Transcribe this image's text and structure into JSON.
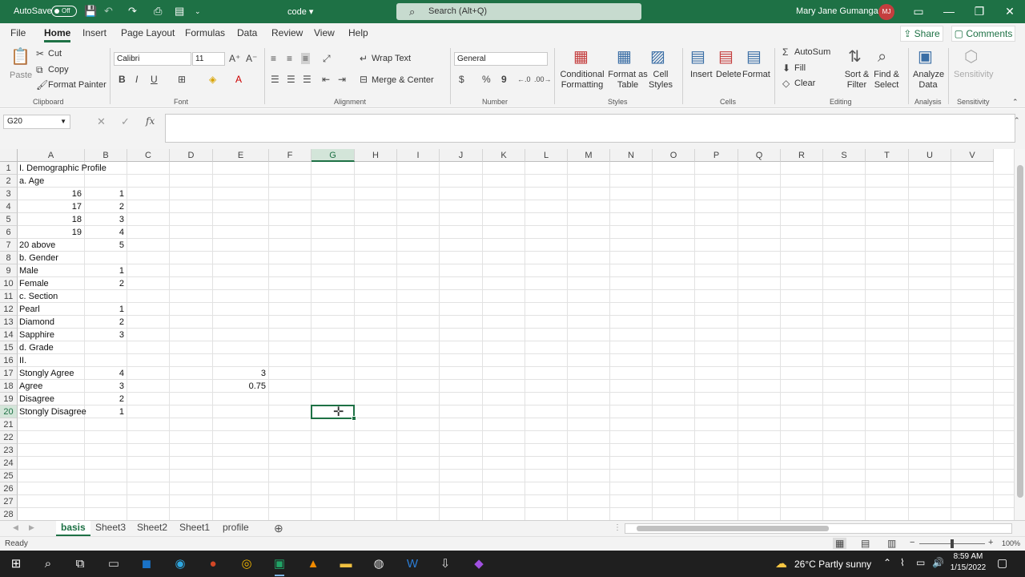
{
  "titlebar": {
    "autosave_label": "AutoSave",
    "autosave_state": "Off",
    "doc_title": "code",
    "doc_title_chevron": "▾",
    "search_placeholder": "Search (Alt+Q)",
    "user_name": "Mary Jane Gumangan",
    "user_initials": "MJ",
    "qat": [
      "save-icon",
      "undo-icon",
      "redo-icon",
      "print-preview-icon",
      "pdf-icon",
      "customize-icon"
    ]
  },
  "menu_tabs": [
    "File",
    "Home",
    "Insert",
    "Page Layout",
    "Formulas",
    "Data",
    "Review",
    "View",
    "Help"
  ],
  "active_tab": "Home",
  "share_label": "Share",
  "comments_label": "Comments",
  "ribbon": {
    "clipboard": {
      "group": "Clipboard",
      "paste": "Paste",
      "cut": "Cut",
      "copy": "Copy",
      "format_painter": "Format Painter"
    },
    "font": {
      "group": "Font",
      "name": "Calibri",
      "size": "11",
      "bold": "B",
      "italic": "I",
      "underline": "U"
    },
    "alignment": {
      "group": "Alignment",
      "wrap_text": "Wrap Text",
      "merge_center": "Merge & Center"
    },
    "number": {
      "group": "Number",
      "format": "General",
      "currency": "$",
      "percent": "%",
      "comma": "9"
    },
    "styles": {
      "group": "Styles",
      "conditional": "Conditional Formatting",
      "format_table": "Format as Table",
      "cell_styles": "Cell Styles"
    },
    "cells": {
      "group": "Cells",
      "insert": "Insert",
      "delete": "Delete",
      "format": "Format"
    },
    "editing": {
      "group": "Editing",
      "autosum": "AutoSum",
      "fill": "Fill",
      "clear": "Clear",
      "sort_filter": "Sort & Filter",
      "find_select": "Find & Select"
    },
    "analysis": {
      "group": "Analysis",
      "analyze": "Analyze Data"
    },
    "sensitivity": {
      "group": "Sensitivity",
      "label": "Sensitivity"
    }
  },
  "name_box": "G20",
  "formula_value": "",
  "columns": [
    "A",
    "B",
    "C",
    "D",
    "E",
    "F",
    "G",
    "H",
    "I",
    "J",
    "K",
    "L",
    "M",
    "N",
    "O",
    "P",
    "Q",
    "R",
    "S",
    "T",
    "U",
    "V"
  ],
  "selected_column": "G",
  "selected_row": 20,
  "rows": [
    1,
    2,
    3,
    4,
    5,
    6,
    7,
    8,
    9,
    10,
    11,
    12,
    13,
    14,
    15,
    16,
    17,
    18,
    19,
    20,
    21,
    22,
    23,
    24,
    25,
    26,
    27,
    28
  ],
  "cells": [
    {
      "row": 1,
      "col": "A",
      "value": "I. Demographic Profile",
      "align": "left"
    },
    {
      "row": 2,
      "col": "A",
      "value": "a. Age",
      "align": "left"
    },
    {
      "row": 3,
      "col": "A",
      "value": "16",
      "align": "right"
    },
    {
      "row": 3,
      "col": "B",
      "value": "1",
      "align": "right"
    },
    {
      "row": 4,
      "col": "A",
      "value": "17",
      "align": "right"
    },
    {
      "row": 4,
      "col": "B",
      "value": "2",
      "align": "right"
    },
    {
      "row": 5,
      "col": "A",
      "value": "18",
      "align": "right"
    },
    {
      "row": 5,
      "col": "B",
      "value": "3",
      "align": "right"
    },
    {
      "row": 6,
      "col": "A",
      "value": "19",
      "align": "right"
    },
    {
      "row": 6,
      "col": "B",
      "value": "4",
      "align": "right"
    },
    {
      "row": 7,
      "col": "A",
      "value": "20 above",
      "align": "left"
    },
    {
      "row": 7,
      "col": "B",
      "value": "5",
      "align": "right"
    },
    {
      "row": 8,
      "col": "A",
      "value": "b. Gender",
      "align": "left"
    },
    {
      "row": 9,
      "col": "A",
      "value": "Male",
      "align": "left"
    },
    {
      "row": 9,
      "col": "B",
      "value": "1",
      "align": "right"
    },
    {
      "row": 10,
      "col": "A",
      "value": "Female",
      "align": "left"
    },
    {
      "row": 10,
      "col": "B",
      "value": "2",
      "align": "right"
    },
    {
      "row": 11,
      "col": "A",
      "value": "c. Section",
      "align": "left"
    },
    {
      "row": 12,
      "col": "A",
      "value": "Pearl",
      "align": "left"
    },
    {
      "row": 12,
      "col": "B",
      "value": "1",
      "align": "right"
    },
    {
      "row": 13,
      "col": "A",
      "value": "Diamond",
      "align": "left"
    },
    {
      "row": 13,
      "col": "B",
      "value": "2",
      "align": "right"
    },
    {
      "row": 14,
      "col": "A",
      "value": "Sapphire",
      "align": "left"
    },
    {
      "row": 14,
      "col": "B",
      "value": "3",
      "align": "right"
    },
    {
      "row": 15,
      "col": "A",
      "value": "d. Grade",
      "align": "left"
    },
    {
      "row": 16,
      "col": "A",
      "value": "II.",
      "align": "left"
    },
    {
      "row": 17,
      "col": "A",
      "value": "Stongly Agree",
      "align": "left"
    },
    {
      "row": 17,
      "col": "B",
      "value": "4",
      "align": "right"
    },
    {
      "row": 17,
      "col": "E",
      "value": "3",
      "align": "right"
    },
    {
      "row": 18,
      "col": "A",
      "value": "Agree",
      "align": "left"
    },
    {
      "row": 18,
      "col": "B",
      "value": "3",
      "align": "right"
    },
    {
      "row": 18,
      "col": "E",
      "value": "0.75",
      "align": "right"
    },
    {
      "row": 19,
      "col": "A",
      "value": "Disagree",
      "align": "left"
    },
    {
      "row": 19,
      "col": "B",
      "value": "2",
      "align": "right"
    },
    {
      "row": 20,
      "col": "A",
      "value": "Stongly Disagree",
      "align": "left"
    },
    {
      "row": 20,
      "col": "B",
      "value": "1",
      "align": "right"
    }
  ],
  "sheets": [
    "basis",
    "Sheet3",
    "Sheet2",
    "Sheet1",
    "profile"
  ],
  "active_sheet": "basis",
  "status": {
    "ready": "Ready",
    "zoom": "100%"
  },
  "taskbar": {
    "weather": "26°C  Partly sunny",
    "time": "8:59 AM",
    "date": "1/15/2022"
  },
  "colors": {
    "accent": "#1e7145",
    "avatar": "#c43e3e",
    "taskbar": "#1f1f1f"
  }
}
